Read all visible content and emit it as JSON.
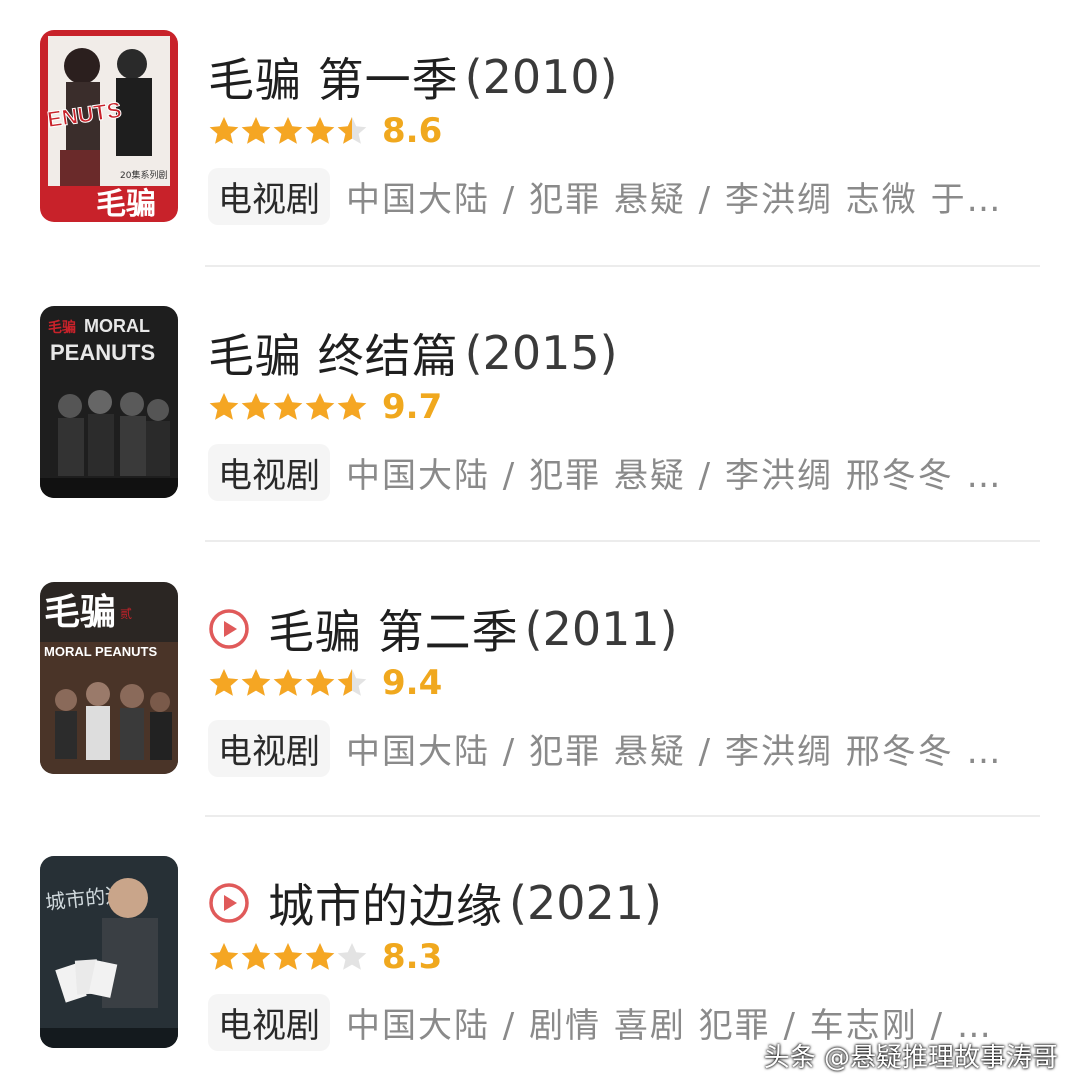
{
  "items": [
    {
      "title": "毛骗 第一季",
      "year": "(2010)",
      "score": "8.6",
      "stars": [
        1,
        1,
        1,
        1,
        0.5
      ],
      "has_play": false,
      "tag": "电视剧",
      "meta": "中国大陆 / 犯罪 悬疑 / 李洪绸 志微 于…",
      "poster": {
        "text_big": "毛骗",
        "text_small": "20集系列剧",
        "badge": "ENUTS",
        "colors": [
          "#c8222a",
          "#f1ece8"
        ]
      }
    },
    {
      "title": "毛骗 终结篇",
      "year": "(2015)",
      "score": "9.7",
      "stars": [
        1,
        1,
        1,
        1,
        1
      ],
      "has_play": false,
      "tag": "电视剧",
      "meta": "中国大陆 / 犯罪 悬疑 / 李洪绸 邢冬冬 …",
      "poster": {
        "text_big": "MORAL",
        "text_small": "PEANUTS",
        "badge": "毛骗",
        "colors": [
          "#1e1e1e",
          "#3a3a3a"
        ]
      }
    },
    {
      "title": "毛骗 第二季",
      "year": "(2011)",
      "score": "9.4",
      "stars": [
        1,
        1,
        1,
        1,
        0.5
      ],
      "has_play": true,
      "tag": "电视剧",
      "meta": "中国大陆 / 犯罪 悬疑 / 李洪绸 邢冬冬 …",
      "poster": {
        "text_big": "毛骗",
        "text_small": "MORAL PEANUTS",
        "badge": "贰",
        "colors": [
          "#2b2623",
          "#8a5a3c"
        ]
      }
    },
    {
      "title": "城市的边缘",
      "year": "(2021)",
      "score": "8.3",
      "stars": [
        1,
        1,
        1,
        1,
        0
      ],
      "has_play": true,
      "tag": "电视剧",
      "meta": "中国大陆 / 剧情 喜剧 犯罪 / 车志刚 / …",
      "poster": {
        "text_big": "城市的边缘",
        "text_small": "",
        "badge": "",
        "colors": [
          "#20262b",
          "#4a5660"
        ]
      }
    }
  ],
  "watermark": "头条 @悬疑推理故事涛哥",
  "colors": {
    "star_full": "#f5a623",
    "star_empty": "#e3e3e3",
    "score": "#f0a81e",
    "play": "#e05a5a"
  }
}
